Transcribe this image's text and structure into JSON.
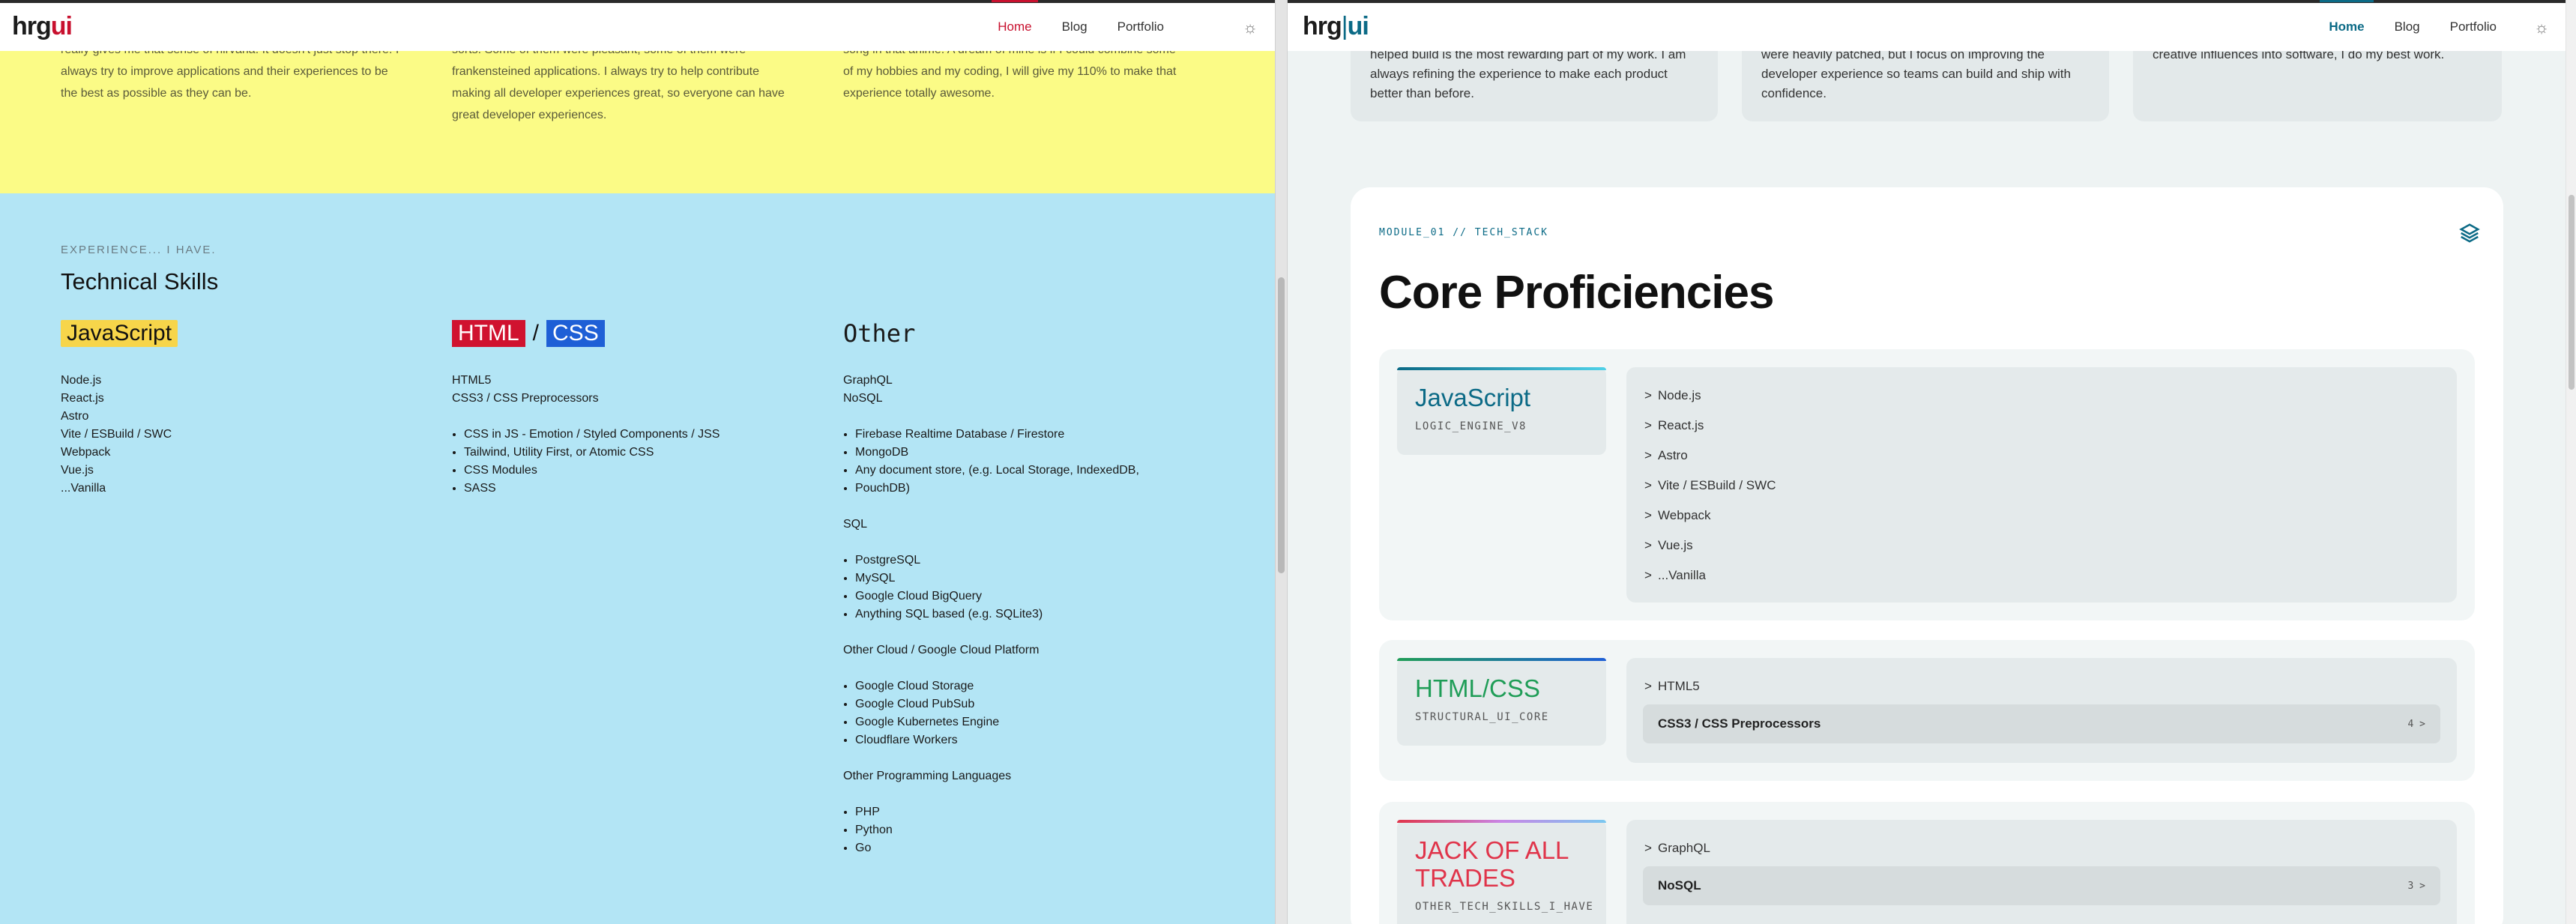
{
  "left": {
    "logo": {
      "a": "hrg",
      "b": "ui"
    },
    "nav": {
      "home": "Home",
      "blog": "Blog",
      "portfolio": "Portfolio"
    },
    "intro": [
      "really gives me that sense of nirvana. It doesn't just stop there. I\nalways try to improve applications and their experiences to be\nthe best as possible as they can be.",
      "sorts. Some of them were pleasant, some of them were\nfrankensteined applications. I always try to help contribute\nmaking all developer experiences great, so everyone can have\ngreat developer experiences.",
      "song in that anime. A dream of mine is if I could combine some\nof my hobbies and my coding, I will give my 110% to make that\nexperience totally awesome."
    ],
    "eyebrow": "EXPERIENCE... I HAVE.",
    "title": "Technical Skills",
    "js": {
      "badge": "JavaScript",
      "items": [
        "Node.js",
        "React.js",
        "Astro",
        "Vite / ESBuild / SWC",
        "Webpack",
        "Vue.js",
        "...Vanilla"
      ]
    },
    "htmlcss": {
      "html": "HTML",
      "slash": "/",
      "css": "CSS",
      "items": [
        "HTML5",
        "CSS3 / CSS Preprocessors"
      ],
      "sub": [
        "CSS in JS - Emotion / Styled Components / JSS",
        "Tailwind, Utility First, or Atomic CSS",
        "CSS Modules",
        "SASS"
      ]
    },
    "other": {
      "title": "Other",
      "top": [
        "GraphQL",
        "NoSQL"
      ],
      "nosql": [
        "Firebase Realtime Database / Firestore",
        "MongoDB",
        "Any document store, (e.g. Local Storage, IndexedDB,",
        "PouchDB)"
      ],
      "sql_label": "SQL",
      "sql": [
        "PostgreSQL",
        "MySQL",
        "Google Cloud BigQuery",
        "Anything SQL based (e.g. SQLite3)"
      ],
      "cloud_label": "Other Cloud / Google Cloud Platform",
      "cloud": [
        "Google Cloud Storage",
        "Google Cloud PubSub",
        "Google Kubernetes Engine",
        "Cloudflare Workers"
      ],
      "lang_label": "Other Programming Languages",
      "lang": [
        "PHP",
        "Python",
        "Go"
      ]
    }
  },
  "right": {
    "logo": {
      "a": "hrg",
      "bar": "|",
      "b": "ui"
    },
    "nav": {
      "home": "Home",
      "blog": "Blog",
      "portfolio": "Portfolio"
    },
    "cards": [
      "helped build is the most rewarding part of my work. I am\nalways refining the experience to make each product\nbetter than before.",
      "were heavily patched, but I focus on improving the\ndeveloper experience so teams can build and ship with\nconfidence.",
      "creative influences into software, I do my best work."
    ],
    "module": {
      "eyebrow": "MODULE_01 // TECH_STACK",
      "title": "Core Proficiencies",
      "rows": [
        {
          "label": "JavaScript",
          "code": "LOGIC_ENGINE_V8",
          "color": "#0b6a86",
          "items": [
            "Node.js",
            "React.js",
            "Astro",
            "Vite / ESBuild / SWC",
            "Webpack",
            "Vue.js",
            "...Vanilla"
          ]
        },
        {
          "label": "HTML/CSS",
          "code": "STRUCTURAL_UI_CORE",
          "color": "#1f9d57",
          "items": [
            "HTML5"
          ],
          "expand": {
            "label": "CSS3 / CSS Preprocessors",
            "count": "4 >"
          }
        },
        {
          "label": "JACK OF ALL TRADES",
          "code": "OTHER_TECH_SKILLS_I_HAVE",
          "color": "#e0344a",
          "items": [
            "GraphQL"
          ],
          "expand": {
            "label": "NoSQL",
            "count": "3 >"
          }
        }
      ]
    }
  }
}
